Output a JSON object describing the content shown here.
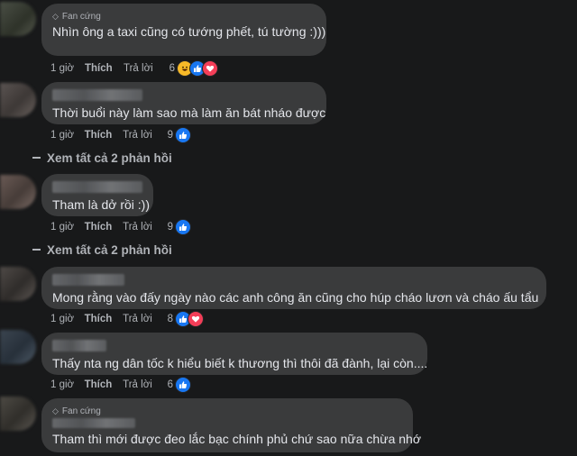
{
  "badge_label": "Fan cứng",
  "comments": [
    {
      "text": "Nhìn ông a taxi cũng có tướng phết, tú tường :)))",
      "time": "1 giờ",
      "like": "Thích",
      "reply": "Trả lời",
      "reactions_count": "6",
      "reactions": [
        "haha",
        "like",
        "love"
      ],
      "badge": true
    },
    {
      "text": "Thời buổi này làm sao mà làm ăn bát nháo được",
      "time": "1 giờ",
      "like": "Thích",
      "reply": "Trả lời",
      "reactions_count": "9",
      "reactions": [
        "like"
      ],
      "badge": false
    },
    {
      "text": "Tham là dở rồi :))",
      "time": "1 giờ",
      "like": "Thích",
      "reply": "Trả lời",
      "reactions_count": "9",
      "reactions": [
        "like"
      ],
      "badge": false
    },
    {
      "text": "Mong rằng vào đấy ngày nào các anh công ăn cũng cho húp cháo lươn và cháo ấu tẩu",
      "time": "1 giờ",
      "like": "Thích",
      "reply": "Trả lời",
      "reactions_count": "8",
      "reactions": [
        "like",
        "love"
      ],
      "badge": false
    },
    {
      "text": "Thấy nta ng dân tốc k hiểu biết k thương thì thôi đã đành, lại còn....",
      "time": "1 giờ",
      "like": "Thích",
      "reply": "Trả lời",
      "reactions_count": "6",
      "reactions": [
        "like"
      ],
      "badge": false
    },
    {
      "text": "Tham thì mới được đeo lắc bạc chính phủ chứ sao nữa chừa nhớ",
      "badge": true
    }
  ],
  "view_replies": [
    {
      "label": "Xem tất cả 2 phản hồi"
    },
    {
      "label": "Xem tất cả 2 phản hồi"
    }
  ],
  "colors": {
    "background": "#18191a",
    "bubble": "#3a3b3c",
    "text": "#e4e6eb",
    "secondary": "#b0b3b8",
    "like_blue": "#1877f2",
    "love_red": "#f33e58",
    "haha_yellow": "#f7b928"
  }
}
